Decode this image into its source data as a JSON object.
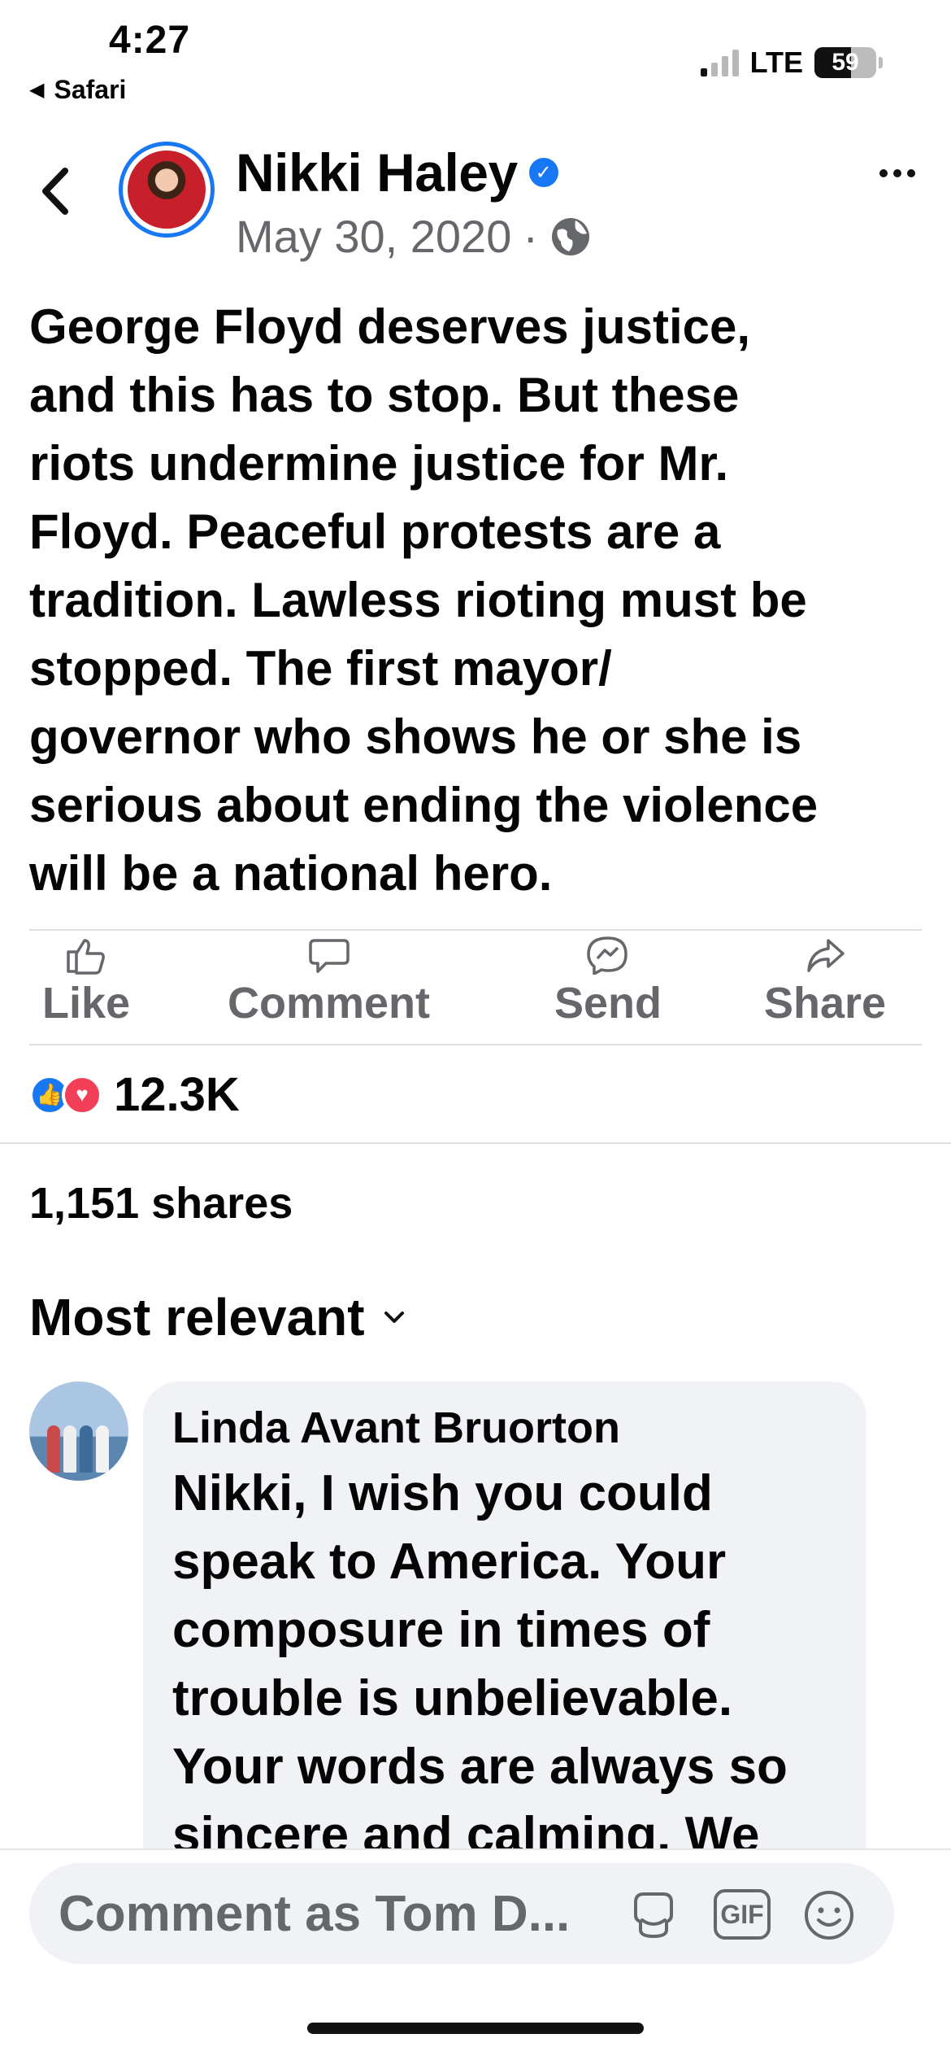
{
  "status_bar": {
    "time": "4:27",
    "back_app": "Safari",
    "network": "LTE",
    "battery": "59",
    "battery_level": 0.59
  },
  "post": {
    "author": "Nikki Haley",
    "date": "May 30, 2020",
    "separator": "·",
    "text": "George Floyd deserves justice,\nand this has to stop. But these\nriots undermine  justice for Mr.\nFloyd.  Peaceful protests are a\ntradition.  Lawless rioting must be\nstopped.  The first mayor/\ngovernor who shows he or she is\nserious about ending the violence\nwill be a national hero."
  },
  "actions": {
    "like": "Like",
    "comment": "Comment",
    "send": "Send",
    "share": "Share"
  },
  "stats": {
    "reactions": "12.3K",
    "shares": "1,151 shares"
  },
  "comments": {
    "sort_label": "Most relevant",
    "items": [
      {
        "name": "Linda Avant Bruorton",
        "text": "Nikki, I wish you could\nspeak to America. Your\ncomposure in times of\ntrouble is unbelievable.\nYour words are always  so\nsincere and calming. We"
      }
    ]
  },
  "composer": {
    "placeholder": "Comment as Tom D...",
    "gif_label": "GIF"
  },
  "colors": {
    "accent": "#1877f2",
    "love": "#f33e58",
    "secondary_text": "#65676b",
    "bubble": "#f0f2f5"
  }
}
